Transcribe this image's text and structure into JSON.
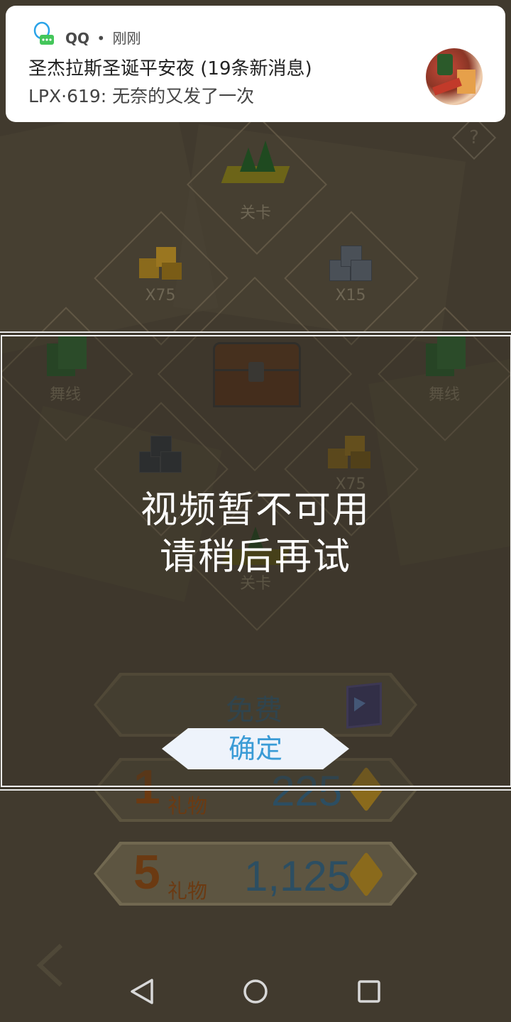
{
  "notification": {
    "app_name": "QQ",
    "separator": "•",
    "time": "刚刚",
    "title": "圣杰拉斯圣诞平安夜 (19条新消息)",
    "message": "LPX·619: 无奈的又发了一次"
  },
  "game": {
    "help_label": "?",
    "items": {
      "level_top": "关卡",
      "gold_top": "X75",
      "block_top": "X15",
      "dance_left": "舞线",
      "dance_right": "舞线",
      "gold_mid": "X75",
      "level_bottom": "关卡"
    },
    "free_label": "免费",
    "offers": [
      {
        "count": "1",
        "unit": "礼物",
        "price": "225"
      },
      {
        "count": "5",
        "unit": "礼物",
        "price": "1,125"
      }
    ]
  },
  "dialog": {
    "line1": "视频暂不可用",
    "line2": "请稍后再试",
    "confirm": "确定"
  },
  "nav": {
    "back_icon": "back-triangle-icon",
    "home_icon": "home-circle-icon",
    "recent_icon": "recent-square-icon"
  }
}
